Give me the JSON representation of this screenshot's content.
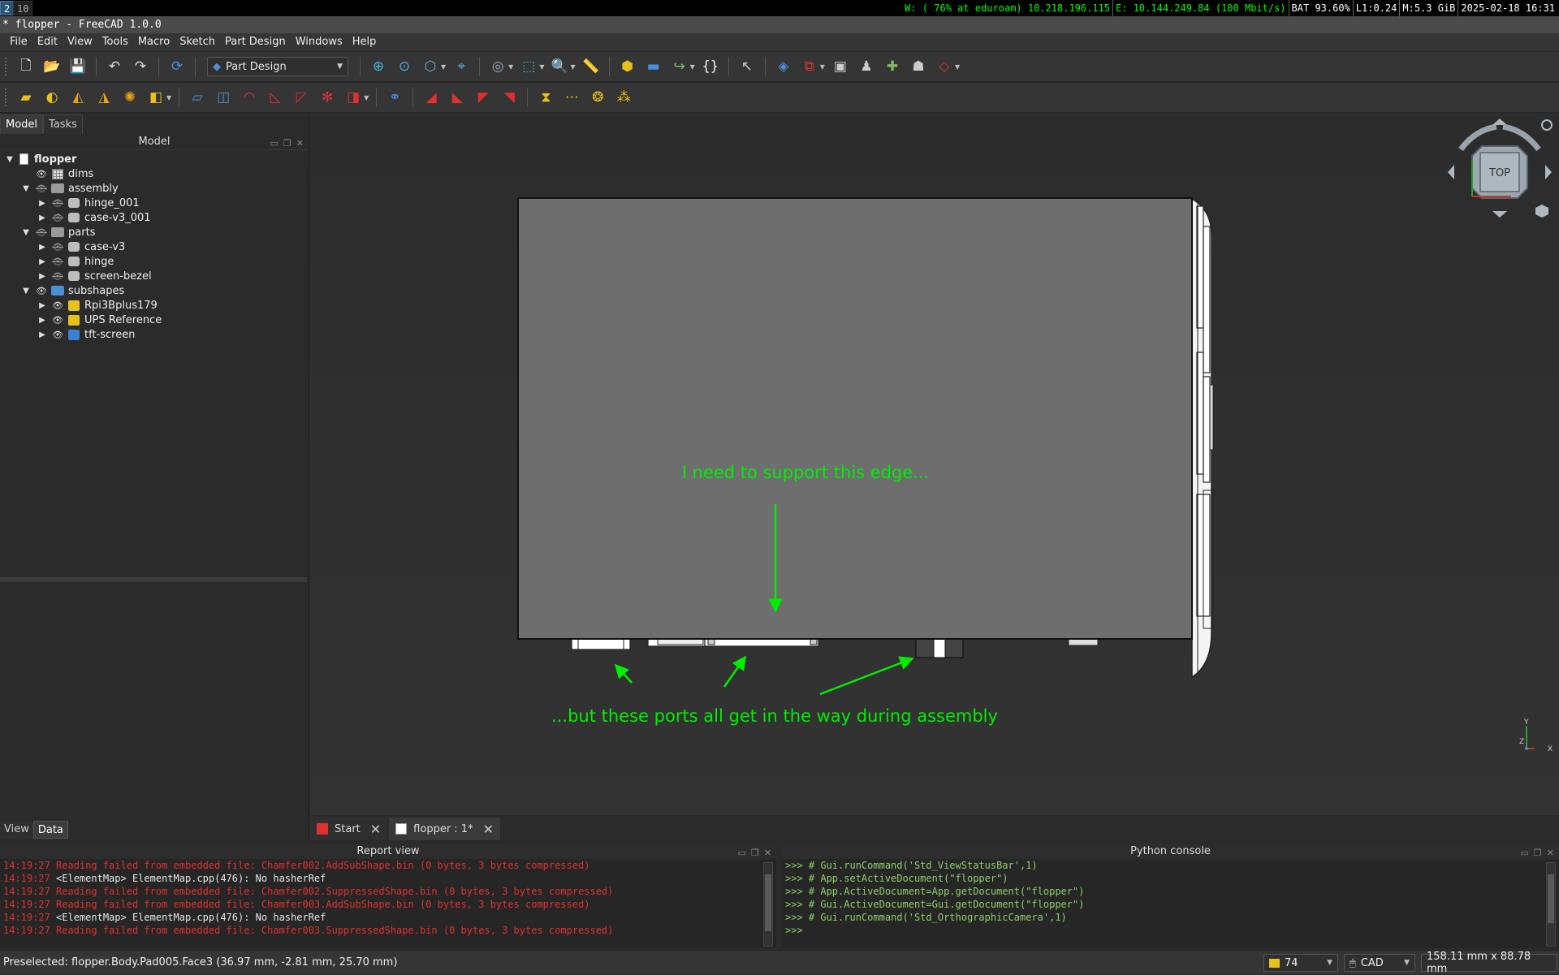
{
  "topbar": {
    "workspaces": [
      "2",
      "10"
    ],
    "wifi": "W: ( 76% at eduroam) 10.218.196.115",
    "ethernet": "E: 10.144.249.84 (100 Mbit/s)",
    "battery": "BAT 93.60%",
    "load": "L1:0.24",
    "memory": "M:5.3 GiB",
    "datetime": "2025-02-18 16:31"
  },
  "window": {
    "title": "* flopper - FreeCAD 1.0.0"
  },
  "menu": [
    "File",
    "Edit",
    "View",
    "Tools",
    "Macro",
    "Sketch",
    "Part Design",
    "Windows",
    "Help"
  ],
  "toolbar": {
    "workbench": "Part Design"
  },
  "combo": {
    "tabs": [
      "Model",
      "Tasks"
    ],
    "header": "Model"
  },
  "tree": [
    {
      "label": "flopper",
      "level": 0,
      "icon": "doc",
      "bold": true,
      "twisty": "open"
    },
    {
      "label": "dims",
      "level": 1,
      "icon": "sheet",
      "vis": true
    },
    {
      "label": "assembly",
      "level": 1,
      "icon": "folder",
      "vis": false,
      "twisty": "open"
    },
    {
      "label": "hinge_001",
      "level": 2,
      "icon": "link",
      "vis": false,
      "twisty": "closed"
    },
    {
      "label": "case-v3_001",
      "level": 2,
      "icon": "link",
      "vis": false,
      "twisty": "closed"
    },
    {
      "label": "parts",
      "level": 1,
      "icon": "folder",
      "vis": false,
      "twisty": "open"
    },
    {
      "label": "case-v3",
      "level": 2,
      "icon": "part",
      "vis": false,
      "twisty": "closed"
    },
    {
      "label": "hinge",
      "level": 2,
      "icon": "part",
      "vis": false,
      "twisty": "closed"
    },
    {
      "label": "screen-bezel",
      "level": 2,
      "icon": "part",
      "vis": false,
      "twisty": "closed"
    },
    {
      "label": "subshapes",
      "level": 1,
      "icon": "folder-blue",
      "vis": true,
      "twisty": "open"
    },
    {
      "label": "Rpi3Bplus179",
      "level": 2,
      "icon": "yellow",
      "vis": true,
      "twisty": "closed"
    },
    {
      "label": "UPS Reference",
      "level": 2,
      "icon": "yellow",
      "vis": true,
      "twisty": "closed"
    },
    {
      "label": "tft-screen",
      "level": 2,
      "icon": "bluepart",
      "vis": true,
      "twisty": "closed"
    }
  ],
  "property_tabs": [
    "View",
    "Data"
  ],
  "viewport": {
    "annotation_top": "I need to support this edge...",
    "annotation_bottom": "...but these ports all get in the way during assembly",
    "navcube_face": "TOP",
    "axis_labels": [
      "Y",
      "Z",
      "X"
    ],
    "annotation_color": "#00ee00"
  },
  "doc_tabs": [
    "Start",
    "flopper : 1*"
  ],
  "report_view": {
    "title": "Report view",
    "lines": [
      {
        "time": "14:19:27",
        "text": "Reading failed from embedded file: Chamfer002.AddSubShape.bin (0 bytes, 3 bytes compressed)",
        "kind": "err"
      },
      {
        "time": "14:19:27",
        "text": "<ElementMap> ElementMap.cpp(476): No hasherRef",
        "kind": "warn"
      },
      {
        "time": "14:19:27",
        "text": "Reading failed from embedded file: Chamfer002.SuppressedShape.bin (0 bytes, 3 bytes compressed)",
        "kind": "err"
      },
      {
        "time": "14:19:27",
        "text": "Reading failed from embedded file: Chamfer003.AddSubShape.bin (0 bytes, 3 bytes compressed)",
        "kind": "err"
      },
      {
        "time": "14:19:27",
        "text": "<ElementMap> ElementMap.cpp(476): No hasherRef",
        "kind": "warn"
      },
      {
        "time": "14:19:27",
        "text": "Reading failed from embedded file: Chamfer003.SuppressedShape.bin (0 bytes, 3 bytes compressed)",
        "kind": "err"
      }
    ]
  },
  "python_console": {
    "title": "Python console",
    "lines": [
      ">>> # Gui.runCommand('Std_ViewStatusBar',1)",
      ">>> # App.setActiveDocument(\"flopper\")",
      ">>> # App.ActiveDocument=App.getDocument(\"flopper\")",
      ">>> # Gui.ActiveDocument=Gui.getDocument(\"flopper\")",
      ">>> # Gui.runCommand('Std_OrthographicCamera',1)",
      ">>>"
    ]
  },
  "statusbar": {
    "preselected": "Preselected: flopper.Body.Pad005.Face3 (36.97 mm, -2.81 mm, 25.70 mm)",
    "counter": "74",
    "nav_style": "CAD",
    "dimensions": "158.11 mm x 88.78 mm"
  }
}
